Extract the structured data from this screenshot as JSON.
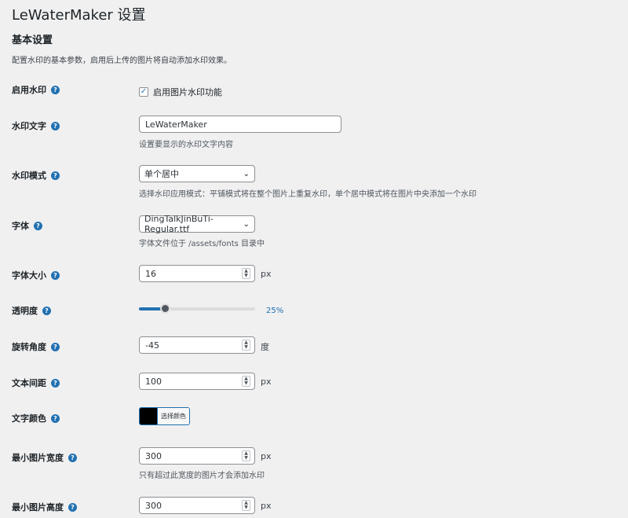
{
  "page": {
    "title": "LeWaterMaker 设置",
    "section_title": "基本设置",
    "section_desc": "配置水印的基本参数，启用后上传的图片将自动添加水印效果。"
  },
  "settings": {
    "enable": {
      "label": "启用水印",
      "checkbox_label": "启用图片水印功能",
      "checked": true
    },
    "text": {
      "label": "水印文字",
      "value": "LeWaterMaker",
      "desc": "设置要显示的水印文字内容"
    },
    "mode": {
      "label": "水印模式",
      "value": "单个居中",
      "desc": "选择水印应用模式：平铺模式将在整个图片上重复水印，单个居中模式将在图片中央添加一个水印"
    },
    "font": {
      "label": "字体",
      "value": "DingTalkJinBuTi-Regular.ttf",
      "desc": "字体文件位于 /assets/fonts 目录中"
    },
    "font_size": {
      "label": "字体大小",
      "value": "16",
      "unit": "px"
    },
    "opacity": {
      "label": "透明度",
      "value_text": "25%",
      "fraction": 0.2
    },
    "rotation": {
      "label": "旋转角度",
      "value": "-45",
      "unit": "度"
    },
    "spacing": {
      "label": "文本间距",
      "value": "100",
      "unit": "px"
    },
    "color": {
      "label": "文字颜色",
      "button_label": "选择颜色",
      "value": "#000000"
    },
    "min_width": {
      "label": "最小图片宽度",
      "value": "300",
      "unit": "px",
      "desc": "只有超过此宽度的图片才会添加水印"
    },
    "min_height": {
      "label": "最小图片高度",
      "value": "300",
      "unit": "px"
    }
  },
  "icons": {
    "help": "help-circle-icon",
    "check": "checkmark-icon",
    "chevron": "chevron-down-icon",
    "spinner": "spinner-arrows-icon"
  },
  "colors": {
    "accent": "#2271b1",
    "background": "#f0f0f1"
  }
}
